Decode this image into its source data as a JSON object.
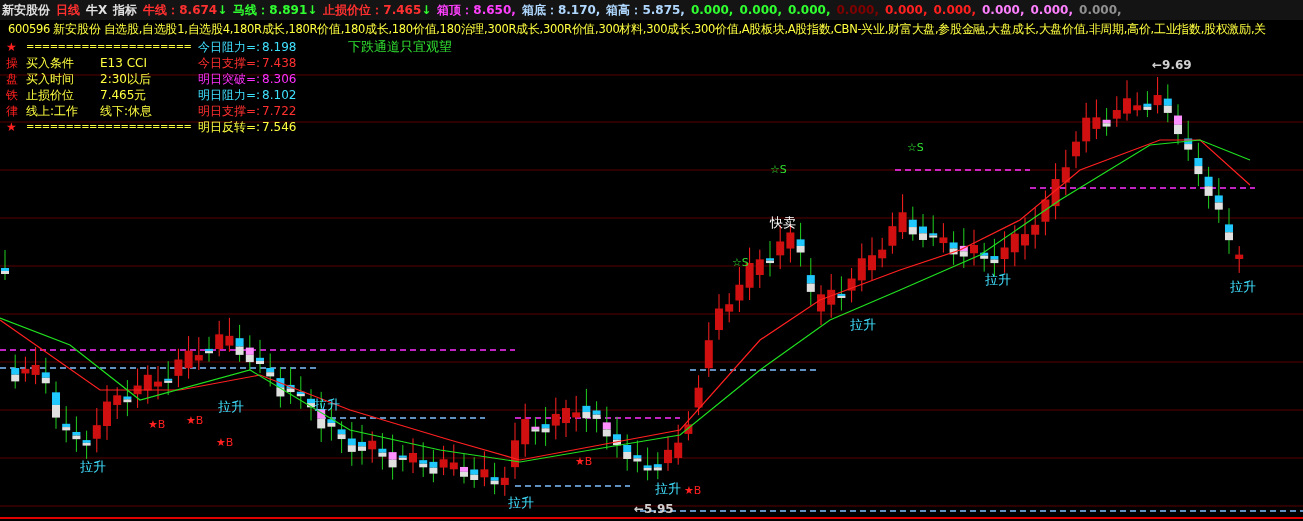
{
  "header": {
    "title": "新安股份",
    "period": "日线",
    "items": [
      "牛X",
      "指标"
    ],
    "indicators": [
      {
        "label": "牛线：",
        "value": "8.674",
        "arrow": "↓",
        "color": "#ff3030"
      },
      {
        "label": "马线：",
        "value": "8.891",
        "arrow": "↓",
        "color": "#30ff30"
      },
      {
        "label": "止损价位：",
        "value": "7.465",
        "arrow": "↓",
        "color": "#ff3030"
      },
      {
        "label": "箱顶：",
        "value": "8.650,",
        "color": "#ff40ff"
      },
      {
        "label": "箱底：",
        "value": "8.170,",
        "color": "#b0d8ff"
      },
      {
        "label": "箱高：",
        "value": "5.875,",
        "color": "#b0d8ff"
      }
    ],
    "values": [
      {
        "value": "0.000,",
        "color": "#30ff30"
      },
      {
        "value": "0.000,",
        "color": "#30ff30"
      },
      {
        "value": "0.000,",
        "color": "#30ff30"
      },
      {
        "value": "0.000,",
        "color": "#800000"
      },
      {
        "value": "0.000,",
        "color": "#ff2020"
      },
      {
        "value": "0.000,",
        "color": "#ff2020"
      },
      {
        "value": "0.000,",
        "color": "#ff80ff"
      },
      {
        "value": "0.000,",
        "color": "#ff80ff"
      },
      {
        "value": "0.000,",
        "color": "#909090"
      }
    ]
  },
  "blocks_line": "600596 新安股份 自选股,自选股1,自选股4,180R成长,180R价值,180成长,180价值,180治理,300R成长,300R价值,300材料,300成长,300价值,A股板块,A股指数,CBN-兴业,财富大盘,参股金融,大盘成长,大盘价值,非周期,高价,工业指数,股权激励,关",
  "plan": [
    {
      "kind": "separator",
      "mark": "★",
      "label": "====================="
    },
    {
      "mark": "操",
      "label": "买入条件",
      "value": "E13 CCI"
    },
    {
      "mark": "盘",
      "label": "买入时间",
      "value": "2:30以后"
    },
    {
      "mark": "铁",
      "label": "止损价位",
      "value": "7.465元"
    },
    {
      "mark": "律",
      "label": "线上:工作",
      "value": "线下:休息"
    },
    {
      "kind": "separator",
      "mark": "★",
      "label": "====================="
    }
  ],
  "levels": [
    {
      "label": "今日阻力=:",
      "value": "8.198",
      "color": "#40e0ff"
    },
    {
      "label": "今日支撑=:",
      "value": "7.438",
      "color": "#ff3030"
    },
    {
      "label": "明日突破=:",
      "value": "8.306",
      "color": "#ff30ff"
    },
    {
      "label": "明日阻力=:",
      "value": "8.102",
      "color": "#40e0ff"
    },
    {
      "label": "明日支撑=:",
      "value": "7.722",
      "color": "#ff3030"
    },
    {
      "label": "明日反转=:",
      "value": "7.546",
      "color": "#ffff40"
    }
  ],
  "advice": "下跌通道只宜观望",
  "annotations": [
    {
      "kind": "rise",
      "text": "拉升"
    },
    {
      "kind": "rise",
      "text": "拉升"
    },
    {
      "kind": "rise",
      "text": "拉升"
    },
    {
      "kind": "rise",
      "text": "拉升"
    },
    {
      "kind": "rise",
      "text": "拉升"
    },
    {
      "kind": "rise",
      "text": "拉升"
    },
    {
      "kind": "rise",
      "text": "拉升"
    },
    {
      "kind": "rise",
      "text": "拉升"
    },
    {
      "kind": "buy",
      "text": "★B"
    },
    {
      "kind": "buy",
      "text": "★B"
    },
    {
      "kind": "buy",
      "text": "★B"
    },
    {
      "kind": "buy",
      "text": "★B"
    },
    {
      "kind": "buy",
      "text": "★B"
    },
    {
      "kind": "sell",
      "text": "☆S"
    },
    {
      "kind": "sell",
      "text": "☆S"
    },
    {
      "kind": "sell",
      "text": "☆S"
    },
    {
      "kind": "sell-fast",
      "text": "快卖"
    },
    {
      "kind": "high",
      "text": "←9.69"
    },
    {
      "kind": "low",
      "text": "←5.95"
    }
  ]
}
